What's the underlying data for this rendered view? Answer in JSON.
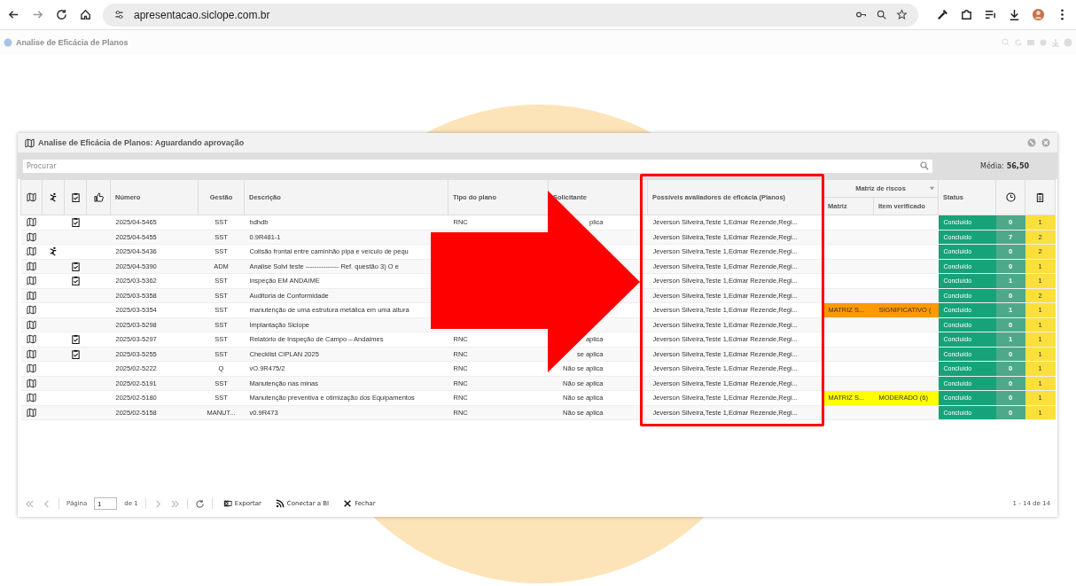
{
  "browser": {
    "url": "apresentacao.siclope.com.br"
  },
  "app_title": "Analise de Eficácia de Planos",
  "panel": {
    "title": "Analise de Eficácia de Planos: Aguardando aprovação"
  },
  "search": {
    "placeholder": "Procurar"
  },
  "media": {
    "label": "Média:",
    "value": "56,50"
  },
  "columns": [
    "Número",
    "Gestão",
    "Descrição",
    "Tipo do plano",
    "Solicitante",
    "Possíveis avaliadores de eficácia (Planos)",
    "Status"
  ],
  "group": {
    "title": "Matriz de riscos",
    "columns": [
      "Matriz",
      "Item verificado"
    ]
  },
  "rows": [
    {
      "person": false,
      "checklist": true,
      "numero": "2025/04-5465",
      "gestao": "SST",
      "descricao": "hdhdb",
      "tipo": "RNC",
      "solicitante": "plica",
      "avaliadores": "Jeverson Silveira,Teste 1,Edmar Rezende,Regi...",
      "status": "Concluído",
      "count": "0",
      "total": "1"
    },
    {
      "person": false,
      "checklist": false,
      "numero": "2025/04-5455",
      "gestao": "SST",
      "descricao": "0.9R481-1",
      "avaliadores": "Jeverson Silveira,Teste 1,Edmar Rezende,Regi...",
      "status": "Concluído",
      "count": "7",
      "total": "2"
    },
    {
      "person": true,
      "checklist": false,
      "numero": "2025/04-5436",
      "gestao": "SST",
      "descricao": "Colisão frontal entre caminhão pipa e veículo de pequ",
      "avaliadores": "Jeverson Silveira,Teste 1,Edmar Rezende,Regi...",
      "status": "Concluído",
      "count": "0",
      "total": "2"
    },
    {
      "person": false,
      "checklist": true,
      "numero": "2025/04-5390",
      "gestao": "ADM",
      "descricao": "Analise Solvi teste --------------- Ref. questão 3) O e",
      "avaliadores": "Jeverson Silveira,Teste 1,Edmar Rezende,Regi...",
      "status": "Concluído",
      "count": "0",
      "total": "1"
    },
    {
      "person": false,
      "checklist": true,
      "numero": "2025/03-5362",
      "gestao": "SST",
      "descricao": "inspeção EM ANDAIME",
      "avaliadores": "Jeverson Silveira,Teste 1,Edmar Rezende,Regi...",
      "status": "Concluído",
      "count": "1",
      "total": "1"
    },
    {
      "person": false,
      "checklist": false,
      "numero": "2025/03-5358",
      "gestao": "SST",
      "descricao": "Auditoria de Conformidade",
      "avaliadores": "Jeverson Silveira,Teste 1,Edmar Rezende,Regi...",
      "status": "Concluído",
      "count": "0",
      "total": "2"
    },
    {
      "person": false,
      "checklist": false,
      "numero": "2025/03-5354",
      "gestao": "SST",
      "descricao": "manutenção de uma estrutura metálica em uma altura",
      "avaliadores": "Jeverson Silveira,Teste 1,Edmar Rezende,Regi...",
      "matriz": "MATRIZ S...",
      "item": "SIGNIFICATIVO (",
      "color": "#ff9900",
      "status": "Concluído",
      "count": "1",
      "total": "1"
    },
    {
      "person": false,
      "checklist": false,
      "numero": "2025/03-5298",
      "gestao": "SST",
      "descricao": "Implantação Siclope",
      "avaliadores": "Jeverson Silveira,Teste 1,Edmar Rezende,Regi...",
      "status": "Concluído",
      "count": "0",
      "total": "1"
    },
    {
      "person": false,
      "checklist": true,
      "numero": "2025/03-5297",
      "gestao": "SST",
      "descricao": "Relatório de Inspeção de Campo – Andaimes",
      "tipo": "RNC",
      "solicitante": "aplica",
      "avaliadores": "Jeverson Silveira,Teste 1,Edmar Rezende,Regi...",
      "status": "Concluído",
      "count": "1",
      "total": "1"
    },
    {
      "person": false,
      "checklist": true,
      "numero": "2025/03-5255",
      "gestao": "SST",
      "descricao": "Checklist CIPLAN 2025",
      "tipo": "RNC",
      "solicitante": "se aplica",
      "avaliadores": "Jeverson Silveira,Teste 1,Edmar Rezende,Regi...",
      "status": "Concluído",
      "count": "0",
      "total": "1"
    },
    {
      "person": false,
      "checklist": false,
      "numero": "2025/02-5222",
      "gestao": "Q",
      "descricao": "vO.9R475/2",
      "tipo": "RNC",
      "solicitante": "Não se aplica",
      "avaliadores": "Jeverson Silveira,Teste 1,Edmar Rezende,Regi...",
      "status": "Concluído",
      "count": "0",
      "total": "1"
    },
    {
      "person": false,
      "checklist": false,
      "numero": "2025/02-5191",
      "gestao": "SST",
      "descricao": "Manutenção nas minas",
      "tipo": "RNC",
      "solicitante": "Não se aplica",
      "avaliadores": "Jeverson Silveira,Teste 1,Edmar Rezende,Regi...",
      "status": "Concluído",
      "count": "0",
      "total": "1"
    },
    {
      "person": false,
      "checklist": false,
      "numero": "2025/02-5180",
      "gestao": "SST",
      "descricao": "Manutenção preventiva e otimização dos Equipamentos",
      "tipo": "RNC",
      "solicitante": "Não se aplica",
      "avaliadores": "Jeverson Silveira,Teste 1,Edmar Rezende,Regi...",
      "matriz": "MATRIZ S...",
      "item": "MODERADO (6)",
      "color": "#ffff00",
      "status": "Concluído",
      "count": "0",
      "total": "1"
    },
    {
      "person": false,
      "checklist": false,
      "numero": "2025/02-5158",
      "gestao": "MANUT...",
      "descricao": "v0.9R473",
      "tipo": "RNC",
      "solicitante": "Não se aplica",
      "avaliadores": "Jeverson Silveira,Teste 1,Edmar Rezende,Regi...",
      "status": "Concluído",
      "count": "0",
      "total": "1"
    }
  ],
  "pager": {
    "label": "Página",
    "page": "1",
    "of": "de 1"
  },
  "actions": [
    "Exportar",
    "Conectar a BI",
    "Fechar"
  ],
  "range": "1 - 14 de 14"
}
